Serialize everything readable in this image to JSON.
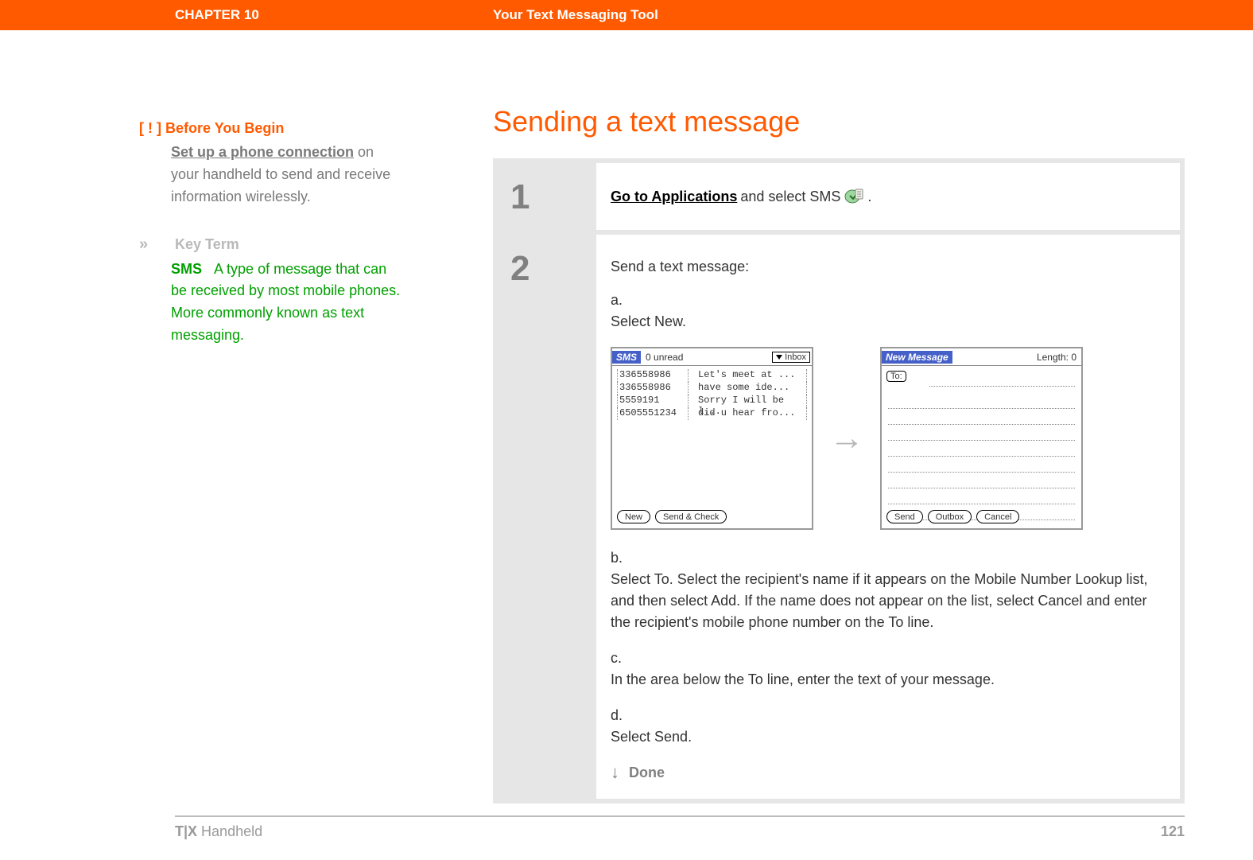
{
  "header": {
    "chapter": "CHAPTER 10",
    "title": "Your Text Messaging Tool"
  },
  "sidebar": {
    "before_you_begin": {
      "marker": "[ ! ]",
      "title": "Before You Begin",
      "link": "Set up a phone connection",
      "body_rest": " on your handheld to send and receive information wirelessly."
    },
    "key_term": {
      "marker": "»",
      "title": "Key Term",
      "term": "SMS",
      "definition": "A type of message that can be received by most mobile phones. More commonly known as text messaging."
    }
  },
  "main": {
    "title": "Sending a text message",
    "step1": {
      "num": "1",
      "link_text": "Go to Applications",
      "after_link": " and select SMS ",
      "period": "."
    },
    "step2": {
      "num": "2",
      "intro": "Send a text message:",
      "a_lbl": "a.",
      "a_txt": "Select New.",
      "b_lbl": "b.",
      "b_txt": "Select To. Select the recipient's name if it appears on the Mobile Number Lookup list, and then select Add. If the name does not appear on the list, select Cancel and enter the recipient's mobile phone number on the To line.",
      "c_lbl": "c.",
      "c_txt": "In the area below the To line, enter the text of your message.",
      "d_lbl": "d.",
      "d_txt": "Select Send.",
      "done": "Done"
    },
    "inbox": {
      "tag": "SMS",
      "unread": "0 unread",
      "folder": "Inbox",
      "rows": [
        {
          "num": "336558986",
          "preview": "Let's meet at ..."
        },
        {
          "num": "336558986",
          "preview": "have some ide..."
        },
        {
          "num": "5559191",
          "preview": "Sorry I will be l..."
        },
        {
          "num": "6505551234",
          "preview": "did u hear fro..."
        }
      ],
      "btn_new": "New",
      "btn_sendcheck": "Send & Check"
    },
    "compose": {
      "tag": "New Message",
      "length_label": "Length: 0",
      "to_label": "To:",
      "btn_send": "Send",
      "btn_outbox": "Outbox",
      "btn_cancel": "Cancel"
    }
  },
  "footer": {
    "product_bold": "T|X",
    "product_rest": " Handheld",
    "page": "121"
  }
}
